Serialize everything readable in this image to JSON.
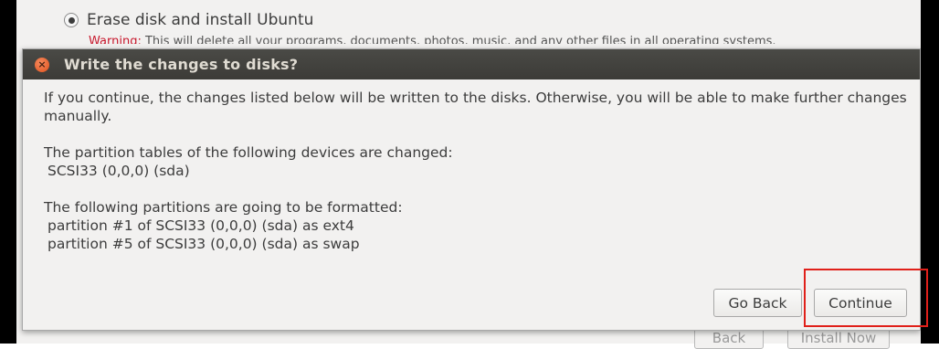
{
  "background": {
    "option_label": "Erase disk and install Ubuntu",
    "warning_prefix": "Warning:",
    "warning_text": " This will delete all your programs, documents, photos, music, and any other files in all operating systems.",
    "back_label": "Back",
    "install_now_label": "Install Now"
  },
  "dialog": {
    "title": "Write the changes to disks?",
    "close_glyph": "×",
    "intro": "If you continue, the changes listed below will be written to the disks. Otherwise, you will be able to make further changes manually.",
    "partition_tables_heading": "The partition tables of the following devices are changed:",
    "partition_tables": [
      "SCSI33 (0,0,0) (sda)"
    ],
    "formatted_heading": "The following partitions are going to be formatted:",
    "formatted": [
      "partition #1 of SCSI33 (0,0,0) (sda) as ext4",
      "partition #5 of SCSI33 (0,0,0) (sda) as swap"
    ],
    "go_back_label": "Go Back",
    "continue_label": "Continue"
  },
  "colors": {
    "titlebar": "#3c3b37",
    "close_button": "#e0521d",
    "highlight_box": "#e0201a"
  }
}
